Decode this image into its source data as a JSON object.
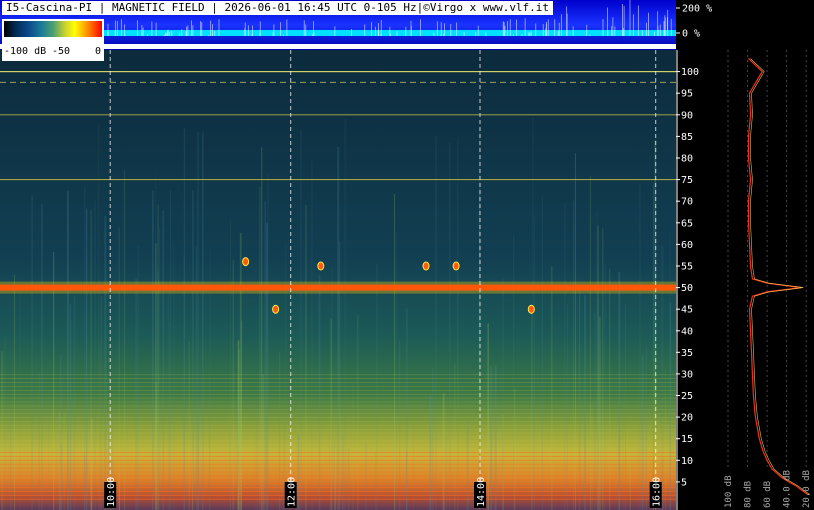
{
  "header": {
    "title": "I5-Cascina-PI | MAGNETIC FIELD | 2026-06-01 16:45 UTC 0-105 Hz|©Virgo x www.vlf.it"
  },
  "color_scale": {
    "labels": [
      "-100 dB",
      "-50",
      "0"
    ],
    "colors": [
      "#000000",
      "#0b4a8a",
      "#4aa070",
      "#ffff00",
      "#ff9a00",
      "#ff0000"
    ]
  },
  "chart_data": [
    {
      "type": "heatmap",
      "ylabel": "",
      "ylim": [
        0,
        105
      ],
      "y_ticks": [
        "5",
        "10",
        "15",
        "20",
        "25",
        "30",
        "35",
        "40",
        "45",
        "50",
        "55",
        "60",
        "65",
        "70",
        "75",
        "80",
        "85",
        "90",
        "95",
        "100"
      ],
      "x_time_labels": [
        "10:00",
        "12:00",
        "14:00",
        "16:00"
      ],
      "x_time_fraction": [
        0.163,
        0.43,
        0.71,
        0.97
      ],
      "dominant_lines_hz": [
        50,
        100,
        75,
        90
      ],
      "hotspots": [
        {
          "hz": 56,
          "time": "11:30"
        },
        {
          "hz": 55,
          "time": "12:20"
        },
        {
          "hz": 55,
          "time": "13:30"
        },
        {
          "hz": 55,
          "time": "13:50"
        },
        {
          "hz": 45,
          "time": "11:50"
        },
        {
          "hz": 45,
          "time": "14:40"
        }
      ]
    },
    {
      "type": "line",
      "ylabel": "",
      "ylim": [
        0,
        105
      ],
      "x_ticks": [
        "100 dB",
        "80 dB",
        "60 dB",
        "40.0 dB",
        "20.0 dB"
      ],
      "x": [
        2,
        4,
        6,
        8,
        10,
        12,
        15,
        20,
        25,
        30,
        35,
        40,
        45,
        48,
        49,
        50,
        51,
        52,
        55,
        60,
        65,
        70,
        75,
        80,
        85,
        90,
        95,
        100,
        103
      ],
      "y_db": [
        -18,
        -30,
        -45,
        -55,
        -60,
        -64,
        -68,
        -72,
        -74,
        -75,
        -76,
        -77,
        -78,
        -75,
        -60,
        -25,
        -60,
        -75,
        -77,
        -78,
        -79,
        -79,
        -77,
        -79,
        -79,
        -77,
        -78,
        -65,
        -79
      ]
    },
    {
      "type": "line",
      "ylabel": "",
      "y_ticks": [
        "200 %",
        "0 %",
        "-200 %"
      ],
      "ylim": [
        -200,
        200
      ]
    }
  ]
}
